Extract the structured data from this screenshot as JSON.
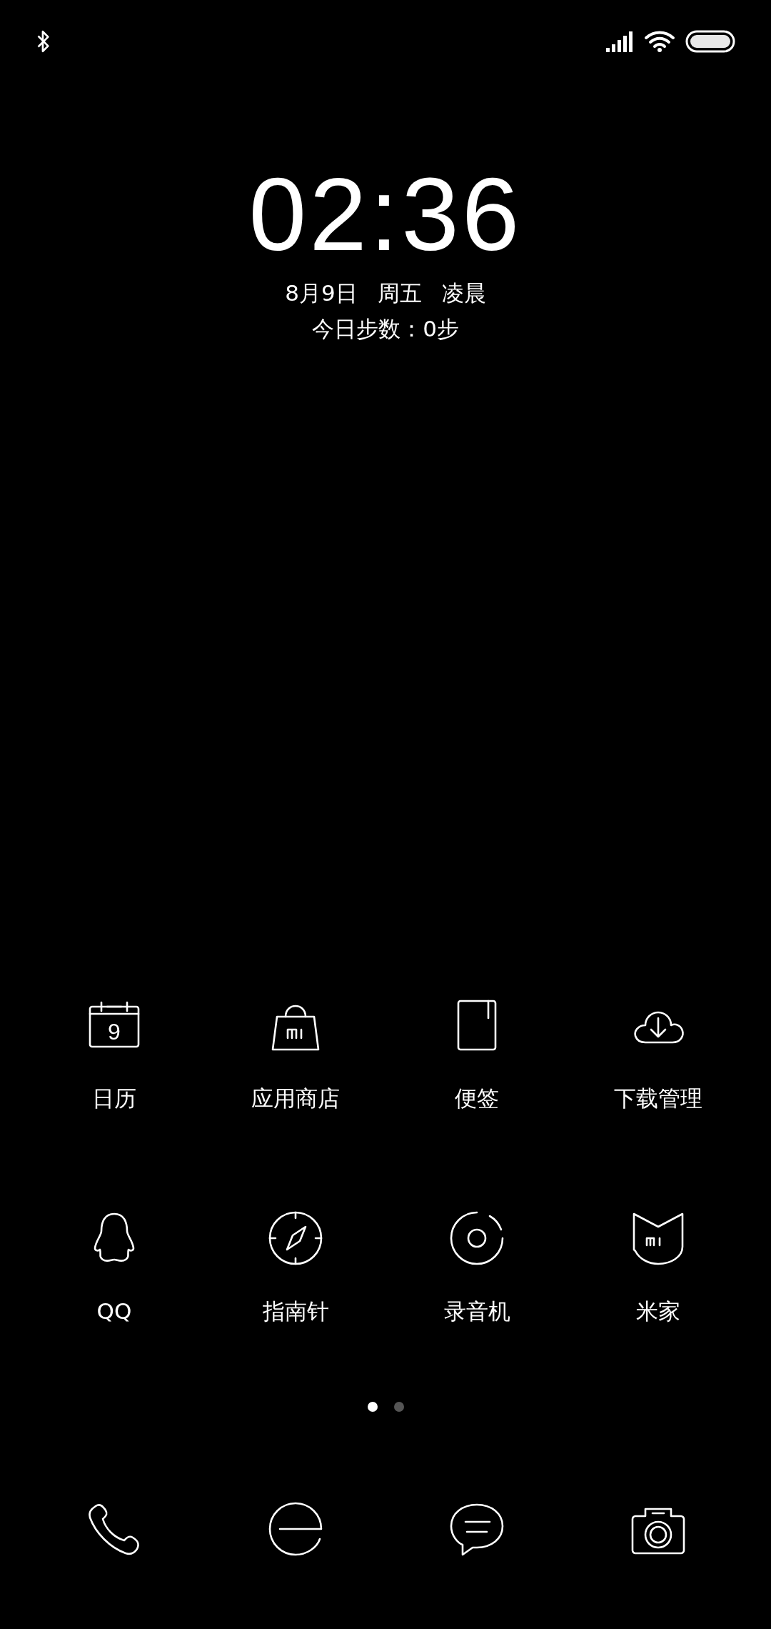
{
  "clock": {
    "time": "02:36",
    "date": "8月9日",
    "weekday": "周五",
    "period": "凌晨",
    "steps": "今日步数：0步"
  },
  "apps": [
    {
      "label": "日历",
      "kind": "calendar",
      "day": "9"
    },
    {
      "label": "应用商店",
      "kind": "bag"
    },
    {
      "label": "便签",
      "kind": "notebook"
    },
    {
      "label": "下载管理",
      "kind": "cloud"
    },
    {
      "label": "QQ",
      "kind": "penguin"
    },
    {
      "label": "指南针",
      "kind": "compass"
    },
    {
      "label": "录音机",
      "kind": "recorder"
    },
    {
      "label": "米家",
      "kind": "shield"
    }
  ],
  "page_indicator": [
    {
      "selected": true
    },
    {
      "selected": false
    }
  ],
  "dock": [
    {
      "kind": "phone"
    },
    {
      "kind": "browser"
    },
    {
      "kind": "chat"
    },
    {
      "kind": "camera"
    }
  ]
}
